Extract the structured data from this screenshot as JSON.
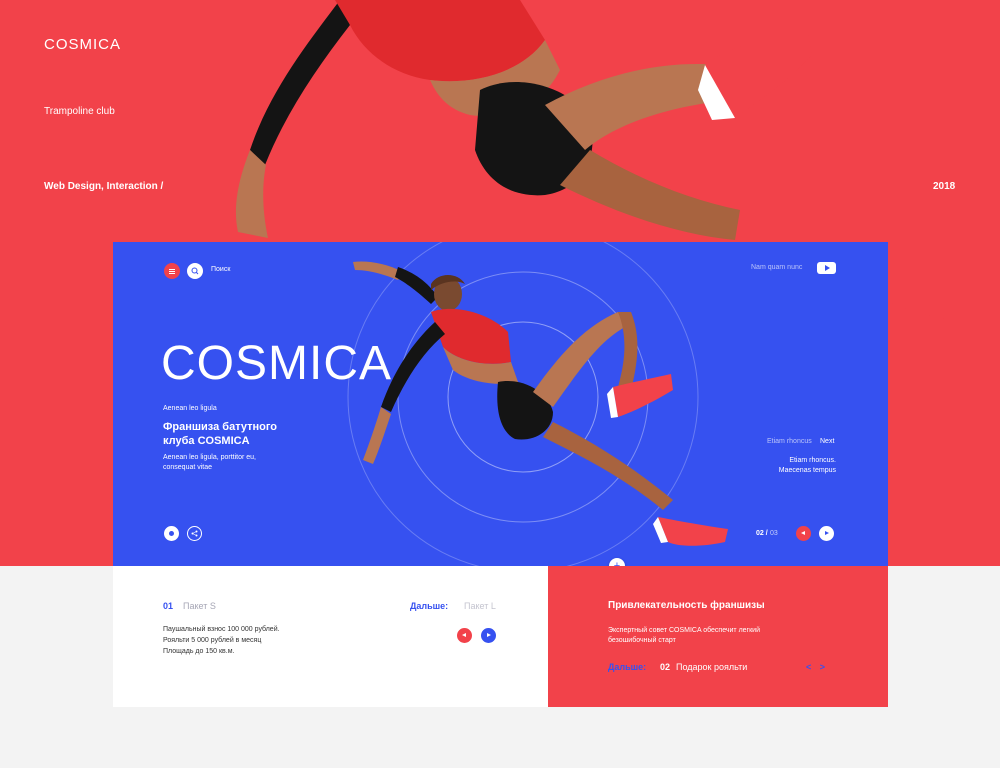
{
  "header": {
    "brand": "COSMICA",
    "tagline": "Trampoline club",
    "project_type": "Web Design, Interaction /",
    "year": "2018"
  },
  "hero": {
    "search_label": "Поиск",
    "top_right_link": "Nam quam nunc",
    "title": "COSMICA",
    "kicker": "Aenean leo ligula",
    "heading": "Франшиза батутного клуба COSMICA",
    "desc": "Aenean leo ligula, porttitor eu, consequat vitae",
    "side_a": "Etiam rhoncus",
    "side_next": "Next",
    "side_b": "Etiam rhoncus.",
    "side_c": "Maecenas tempus",
    "pager_current": "02 /",
    "pager_total": "03"
  },
  "add_button": "+",
  "package_panel": {
    "number": "01",
    "name": "Пакет S",
    "next_label": "Дальше:",
    "next_name": "Пакет L",
    "lines": [
      "Паушальный взнос 100 000 рублей.",
      "Рояльти 5 000 рублей в месяц",
      "Площадь до 150 кв.м."
    ]
  },
  "franchise_panel": {
    "title": "Привлекательность франшизы",
    "desc": "Экспертный совет COSMICA обеспечит легкий безошибочный старт",
    "next_label": "Дальше:",
    "number": "02",
    "name": "Подарок рояльти",
    "arrows": "< >"
  },
  "colors": {
    "red": "#f2424a",
    "blue": "#3651f0",
    "skin": "#b97652",
    "black": "#141414"
  },
  "icons": [
    "menu-icon",
    "search-icon",
    "play-icon",
    "like-icon",
    "share-icon",
    "arrow-left-icon",
    "arrow-right-icon",
    "plus-icon"
  ]
}
